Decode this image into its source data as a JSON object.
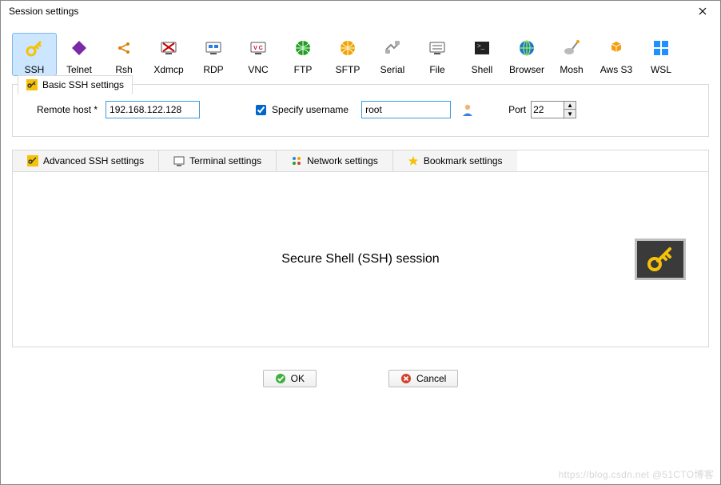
{
  "window": {
    "title": "Session settings"
  },
  "session_types": [
    {
      "id": "ssh",
      "label": "SSH",
      "selected": true
    },
    {
      "id": "telnet",
      "label": "Telnet",
      "selected": false
    },
    {
      "id": "rsh",
      "label": "Rsh",
      "selected": false
    },
    {
      "id": "xdmcp",
      "label": "Xdmcp",
      "selected": false
    },
    {
      "id": "rdp",
      "label": "RDP",
      "selected": false
    },
    {
      "id": "vnc",
      "label": "VNC",
      "selected": false
    },
    {
      "id": "ftp",
      "label": "FTP",
      "selected": false
    },
    {
      "id": "sftp",
      "label": "SFTP",
      "selected": false
    },
    {
      "id": "serial",
      "label": "Serial",
      "selected": false
    },
    {
      "id": "file",
      "label": "File",
      "selected": false
    },
    {
      "id": "shell",
      "label": "Shell",
      "selected": false
    },
    {
      "id": "browser",
      "label": "Browser",
      "selected": false
    },
    {
      "id": "mosh",
      "label": "Mosh",
      "selected": false
    },
    {
      "id": "aws",
      "label": "Aws S3",
      "selected": false
    },
    {
      "id": "wsl",
      "label": "WSL",
      "selected": false
    }
  ],
  "basic_tab": {
    "label": "Basic SSH settings"
  },
  "fields": {
    "remote_host_label": "Remote host *",
    "remote_host_value": "192.168.122.128",
    "specify_username_label": "Specify username",
    "specify_username_checked": true,
    "username_value": "root",
    "port_label": "Port",
    "port_value": "22"
  },
  "adv_tabs": {
    "advanced": "Advanced SSH settings",
    "terminal": "Terminal settings",
    "network": "Network settings",
    "bookmark": "Bookmark settings"
  },
  "main_heading": "Secure Shell (SSH) session",
  "buttons": {
    "ok": "OK",
    "cancel": "Cancel"
  },
  "watermark": "https://blog.csdn.net  @51CTO博客",
  "colors": {
    "accent_blue": "#3e9adf",
    "selected_bg": "#cde6ff",
    "key_yellow": "#f5c20a"
  }
}
